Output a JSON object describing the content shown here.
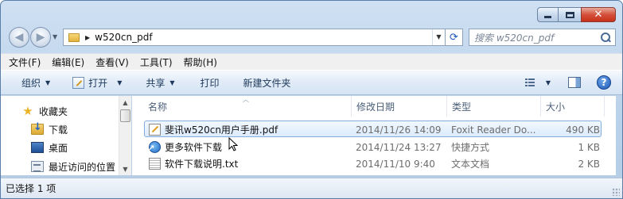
{
  "window": {
    "caption_buttons": {
      "minimize": "",
      "maximize": "",
      "close": "✕"
    }
  },
  "navigation": {
    "back_glyph": "◀",
    "forward_glyph": "▶",
    "address_path": "w520cn_pdf",
    "address_chevron": "▶",
    "address_dropdown": "▼",
    "refresh_glyph": "⟳",
    "search_placeholder": "搜索 w520cn_pdf"
  },
  "menubar": {
    "items": [
      "文件(F)",
      "编辑(E)",
      "查看(V)",
      "工具(T)",
      "帮助(H)"
    ]
  },
  "commandbar": {
    "organize": "组织",
    "open": "打开",
    "share": "共享",
    "print": "打印",
    "new_folder": "新建文件夹",
    "dropdown_arrow": "▼",
    "help": "?"
  },
  "navpane": {
    "items": [
      {
        "label": "收藏夹",
        "icon": "star-icon"
      },
      {
        "label": "下载",
        "icon": "downloads-folder-icon"
      },
      {
        "label": "桌面",
        "icon": "desktop-icon"
      },
      {
        "label": "最近访问的位置",
        "icon": "recent-places-icon"
      }
    ],
    "scroll_up": "▲",
    "scroll_down": "▼"
  },
  "filelist": {
    "columns": {
      "name": "名称",
      "modified": "修改日期",
      "type": "类型",
      "size": "大小"
    },
    "sort_caret": "︿",
    "rows": [
      {
        "name": "斐讯w520cn用户手册.pdf",
        "modified": "2014/11/26 14:09",
        "type": "Foxit Reader Do...",
        "size": "490 KB",
        "icon": "pdf-file-icon",
        "selected": true
      },
      {
        "name": "更多软件下载",
        "modified": "2014/11/24 13:27",
        "type": "快捷方式",
        "size": "1 KB",
        "icon": "shortcut-icon",
        "selected": false
      },
      {
        "name": "软件下载说明.txt",
        "modified": "2014/11/10 9:40",
        "type": "文本文档",
        "size": "2 KB",
        "icon": "text-file-icon",
        "selected": false
      }
    ]
  },
  "status": {
    "text": "已选择 1 项"
  }
}
